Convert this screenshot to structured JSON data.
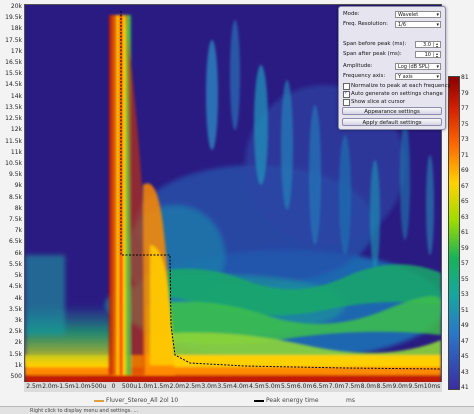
{
  "yaxis": {
    "ticks": [
      "20k",
      "19.5k",
      "18k",
      "17.5k",
      "17k",
      "16.5k",
      "15.5k",
      "14.5k",
      "14k",
      "13.5k",
      "12.5k",
      "12k",
      "11.5k",
      "11k",
      "10.5k",
      "9.5k",
      "9k",
      "8.5k",
      "8k",
      "7.5k",
      "7k",
      "6.5k",
      "6k",
      "5.5k",
      "5k",
      "4.5k",
      "4k",
      "3.5k",
      "3k",
      "2.5k",
      "2k",
      "1.5k",
      "1k",
      "500"
    ]
  },
  "xaxis": {
    "ticks": [
      "2.5m",
      "2.0m",
      "-1.5m",
      "-1.0m",
      "-500u",
      "0",
      "500u",
      "1.0m",
      "1.5m",
      "2.0m",
      "2.5m",
      "3.0m",
      "3.5m",
      "4.0m",
      "4.5m",
      "5.0m",
      "5.5m",
      "6.0m",
      "6.5m",
      "7.0m",
      "7.5m",
      "8.0m",
      "8.5m",
      "9.0m",
      "9.5m",
      "10ms"
    ]
  },
  "colorbar": {
    "ticks": [
      "81",
      "79",
      "77",
      "75",
      "73",
      "71",
      "69",
      "67",
      "65",
      "63",
      "61",
      "59",
      "57",
      "55",
      "53",
      "51",
      "49",
      "47",
      "45",
      "43",
      "41"
    ]
  },
  "panel": {
    "mode_label": "Mode:",
    "mode_value": "Wavelet",
    "freq_res_label": "Freq. Resolution:",
    "freq_res_value": "1/6",
    "span_before_label": "Span before peak (ms):",
    "span_before_value": "3.0",
    "span_after_label": "Span after peak (ms):",
    "span_after_value": "10",
    "amplitude_label": "Amplitude:",
    "amplitude_value": "Log (dB SPL)",
    "freq_axis_label": "Frequency axis:",
    "freq_axis_value": "Y axis",
    "normalize_label": "Normalize to peak at each frequency",
    "auto_generate_label": "Auto generate on settings change",
    "show_slice_label": "Show slice at cursor",
    "appearance_button": "Appearance settings",
    "apply_default_button": "Apply default settings"
  },
  "legend": {
    "series1": "Fluver_Stereo_All 2ol 10",
    "series2": "Peak energy time",
    "series2_unit": "ms"
  },
  "status": {
    "text": "Right click to display menu and settings. ..."
  },
  "colors": {
    "plot_bg": "#2a1b82",
    "peak_line": "#ffcc00",
    "series1_color": "#e0a040",
    "series2_color": "#000000"
  }
}
